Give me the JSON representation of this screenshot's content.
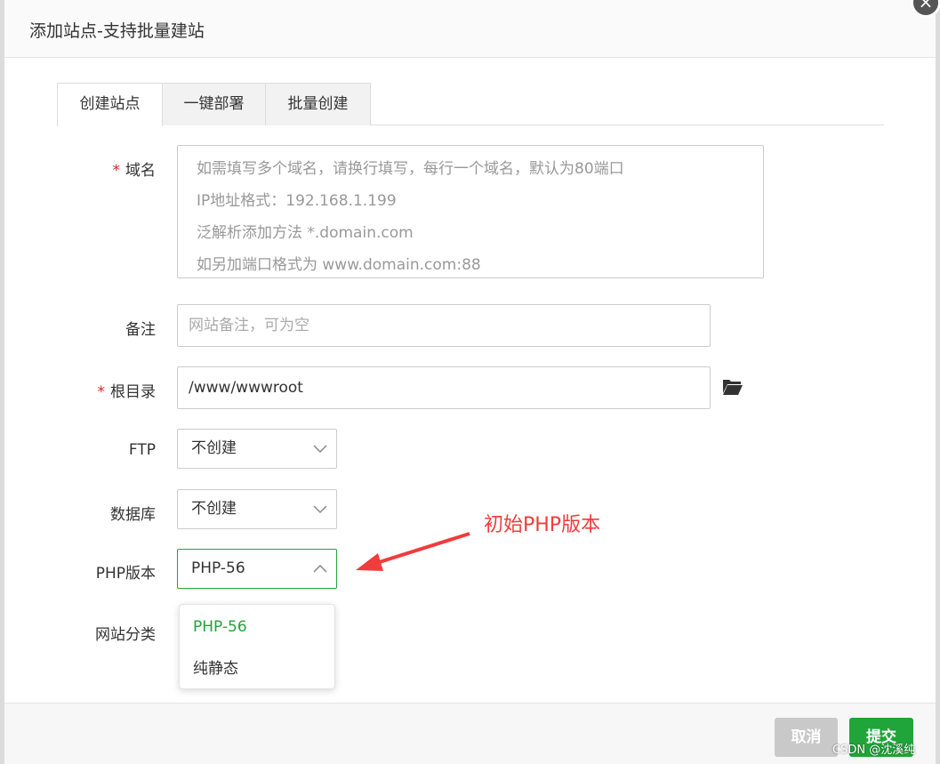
{
  "dialog": {
    "title": "添加站点-支持批量建站",
    "close_glyph": "×"
  },
  "tabs": [
    {
      "label": "创建站点",
      "active": true
    },
    {
      "label": "一键部署",
      "active": false
    },
    {
      "label": "批量创建",
      "active": false
    }
  ],
  "form": {
    "domain": {
      "required_mark": "*",
      "label": "域名",
      "placeholder_lines": [
        "如需填写多个域名，请换行填写，每行一个域名，默认为80端口",
        "IP地址格式：192.168.1.199",
        "泛解析添加方法 *.domain.com",
        "如另加端口格式为 www.domain.com:88"
      ]
    },
    "remark": {
      "label": "备注",
      "placeholder": "网站备注，可为空"
    },
    "root": {
      "required_mark": "*",
      "label": "根目录",
      "value": "/www/wwwroot",
      "icon": "folder-open-icon"
    },
    "ftp": {
      "label": "FTP",
      "value": "不创建"
    },
    "database": {
      "label": "数据库",
      "value": "不创建"
    },
    "php": {
      "label": "PHP版本",
      "value": "PHP-56",
      "options": [
        "PHP-56",
        "纯静态"
      ]
    },
    "category": {
      "label": "网站分类"
    }
  },
  "annotation": {
    "text": "初始PHP版本",
    "color": "#f03c3c"
  },
  "footer": {
    "cancel_label": "取消",
    "submit_label": "提交"
  },
  "watermark": "CSDN @沈溪纯",
  "colors": {
    "accent": "#20a53a",
    "required": "#e02020"
  }
}
